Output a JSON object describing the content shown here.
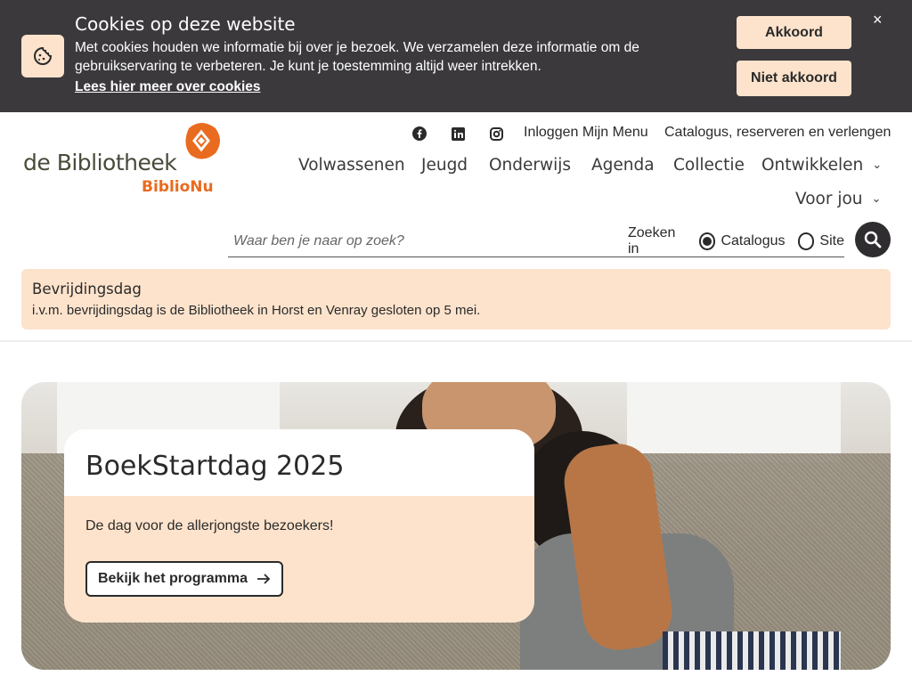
{
  "cookie": {
    "title": "Cookies op deze website",
    "text": "Met cookies houden we informatie bij over je bezoek. We verzamelen deze informatie om de gebruikservaring te verbeteren. Je kunt je toestemming altijd weer intrekken.",
    "link": "Lees hier meer over cookies",
    "accept": "Akkoord",
    "decline": "Niet akkoord",
    "close": "×"
  },
  "logo": {
    "main": "de Bibliotheek",
    "sub": "BiblioNu"
  },
  "top_links": {
    "login": "Inloggen Mijn Menu",
    "catalog": "Catalogus, reserveren en verlengen"
  },
  "social_icons": [
    "facebook-icon",
    "linkedin-icon",
    "instagram-icon"
  ],
  "nav": [
    "Volwassenen",
    "Jeugd",
    "Onderwijs",
    "Agenda",
    "Collectie",
    "Ontwikkelen",
    "Voor jou"
  ],
  "search": {
    "placeholder": "Waar ben je naar op zoek?",
    "scope_label": "Zoeken in",
    "options": [
      "Catalogus",
      "Site"
    ],
    "selected": "Catalogus"
  },
  "notice": {
    "title": "Bevrijdingsdag",
    "text": "i.v.m. bevrijdingsdag is de Bibliotheek in Horst en Venray gesloten op 5 mei."
  },
  "hero": {
    "title": "BoekStartdag 2025",
    "subtitle": "De dag voor de allerjongste bezoekers!",
    "button": "Bekijk het programma"
  },
  "colors": {
    "accent": "#fde3cc",
    "dark": "#3b393c",
    "brand_orange": "#e96b1f"
  }
}
